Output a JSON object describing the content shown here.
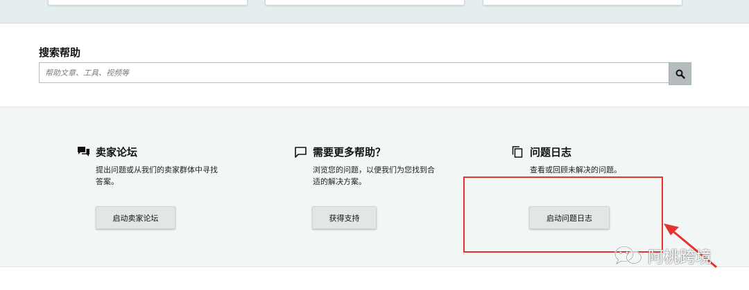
{
  "search": {
    "title": "搜索帮助",
    "placeholder": "帮助文章、工具、视频等"
  },
  "help_columns": [
    {
      "icon": "forum-icon",
      "title": "卖家论坛",
      "desc": "提出问题或从我们的卖家群体中寻找答案。",
      "button": "启动卖家论坛"
    },
    {
      "icon": "chat-bubble-icon",
      "title": "需要更多帮助？",
      "desc": "浏览您的问题，以便我们为您找到合适的解决方案。",
      "button": "获得支持"
    },
    {
      "icon": "copy-document-icon",
      "title": "问题日志",
      "desc": "查看或回顾未解决的问题。",
      "button": "启动问题日志"
    }
  ],
  "watermark": "阿桃跨境",
  "colors": {
    "top_band": "#e4eeee",
    "help_band": "#f2f6f6",
    "search_button": "#b5bcbd",
    "annotation_red": "#e8312a"
  }
}
